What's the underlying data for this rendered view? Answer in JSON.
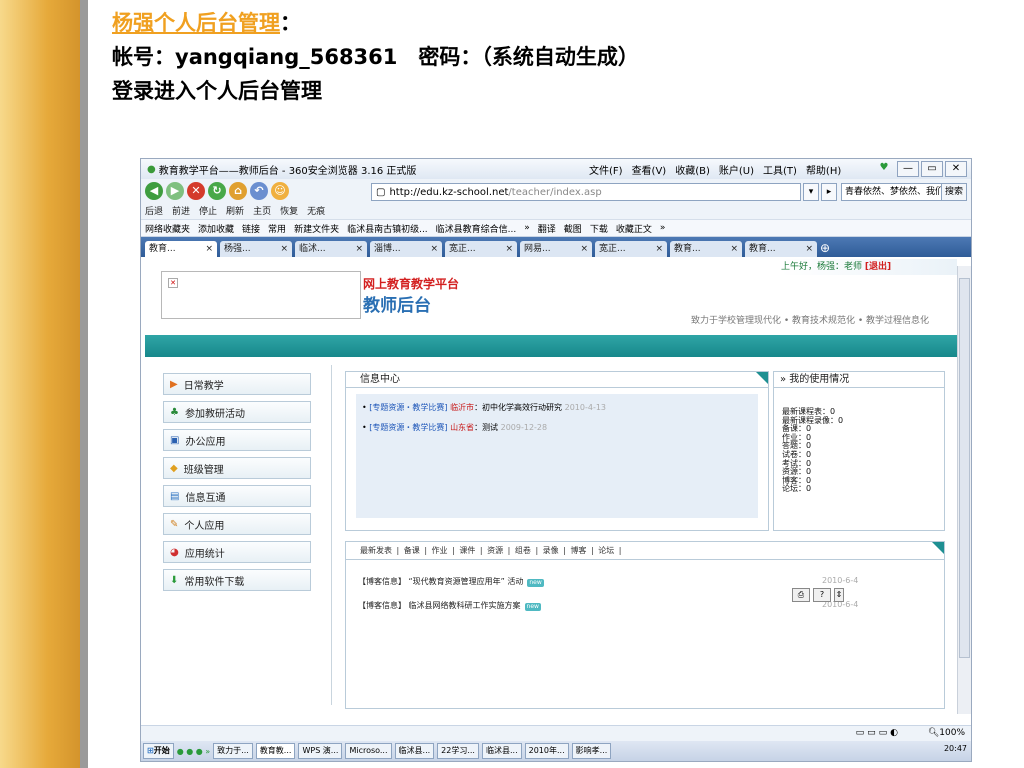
{
  "slide": {
    "line1_link": "杨强个人后台管理",
    "line1_suffix": "：",
    "line2": "帐号：yangqiang_568361　密码：（系统自动生成）",
    "line3": "登录进入个人后台管理"
  },
  "browser": {
    "title": "教育教学平台——教师后台 - 360安全浏览器 3.16 正式版",
    "menu": [
      "文件(F)",
      "查看(V)",
      "收藏(B)",
      "账户(U)",
      "工具(T)",
      "帮助(H)"
    ],
    "nav_labels": [
      "后退",
      "前进",
      "停止",
      "刷新",
      "主页",
      "恢复",
      "无痕"
    ],
    "address_host": "http://edu.kz-school.net",
    "address_path": "/teacher/index.asp",
    "search_text": "青春依然、梦依然、我们",
    "search_button": "搜索",
    "favorites": [
      "网络收藏夹",
      "添加收藏",
      "链接",
      "常用",
      "新建文件夹",
      "临沭县南古镇初级...",
      "临沭县教育综合信...",
      "»",
      "翻译",
      "截图",
      "下载",
      "收藏正文",
      "»"
    ],
    "tabs": [
      {
        "label": "教育..."
      },
      {
        "label": "杨强..."
      },
      {
        "label": "临沭..."
      },
      {
        "label": "淄博..."
      },
      {
        "label": "宽正..."
      },
      {
        "label": "网易..."
      },
      {
        "label": "宽正..."
      },
      {
        "label": "教育..."
      },
      {
        "label": "教育..."
      }
    ],
    "tab_close": "×"
  },
  "page": {
    "greeting_prefix": "上午好，杨强：老师",
    "greeting_exit": "[退出]",
    "platform_name": "网上教育教学平台",
    "backend_name": "教师后台",
    "slogan": "致力于学校管理现代化 • 教育技术规范化 • 教学过程信息化",
    "left_menu": [
      "日常教学",
      "参加教研活动",
      "办公应用",
      "班级管理",
      "信息互通",
      "个人应用",
      "应用统计",
      "常用软件下载"
    ],
    "info_center": {
      "title": "信息中心",
      "items": [
        {
          "tag": "[专题资源・教学比赛]",
          "place": "临沂市",
          "text": "：初中化学高效行动研究",
          "date": "2010-4-13"
        },
        {
          "tag": "[专题资源・教学比赛]",
          "place": "山东省",
          "text": "：测试",
          "date": "2009-12-28"
        }
      ]
    },
    "usage": {
      "title": "» 我的使用情况",
      "lines": [
        "最新课程表：0",
        "最新课程录像：0",
        "备课：0",
        "作业：0",
        "答题：0",
        "试卷：0",
        "考试：0",
        "资源：0",
        "博客：0",
        "论坛：0"
      ]
    },
    "latest": {
      "tabs_text": "最新发表 | 备课 | 作业 | 课件 | 资源 | 组卷 | 录像 | 博客 | 论坛 |",
      "items": [
        {
          "text": "【博客信息】 “现代教育资源管理应用年” 活动",
          "date": "2010-6-4"
        },
        {
          "text": "【博客信息】 临沭县网络教科研工作实施方案",
          "date": "2010-6-4"
        }
      ],
      "new_badge": "new"
    }
  },
  "status": {
    "zoom": "100%"
  },
  "taskbar": {
    "start": "开始",
    "tasks": [
      "致力于...",
      "教育教...",
      "WPS 演...",
      "Microso...",
      "临沭县...",
      "22学习...",
      "临沭县...",
      "2010年...",
      "影响孝..."
    ],
    "time": "20:47"
  },
  "colors": {
    "teal": "#1e8f92",
    "link_orange": "#f0a020",
    "platform_red": "#d32020",
    "backend_blue": "#2a6fb3"
  }
}
